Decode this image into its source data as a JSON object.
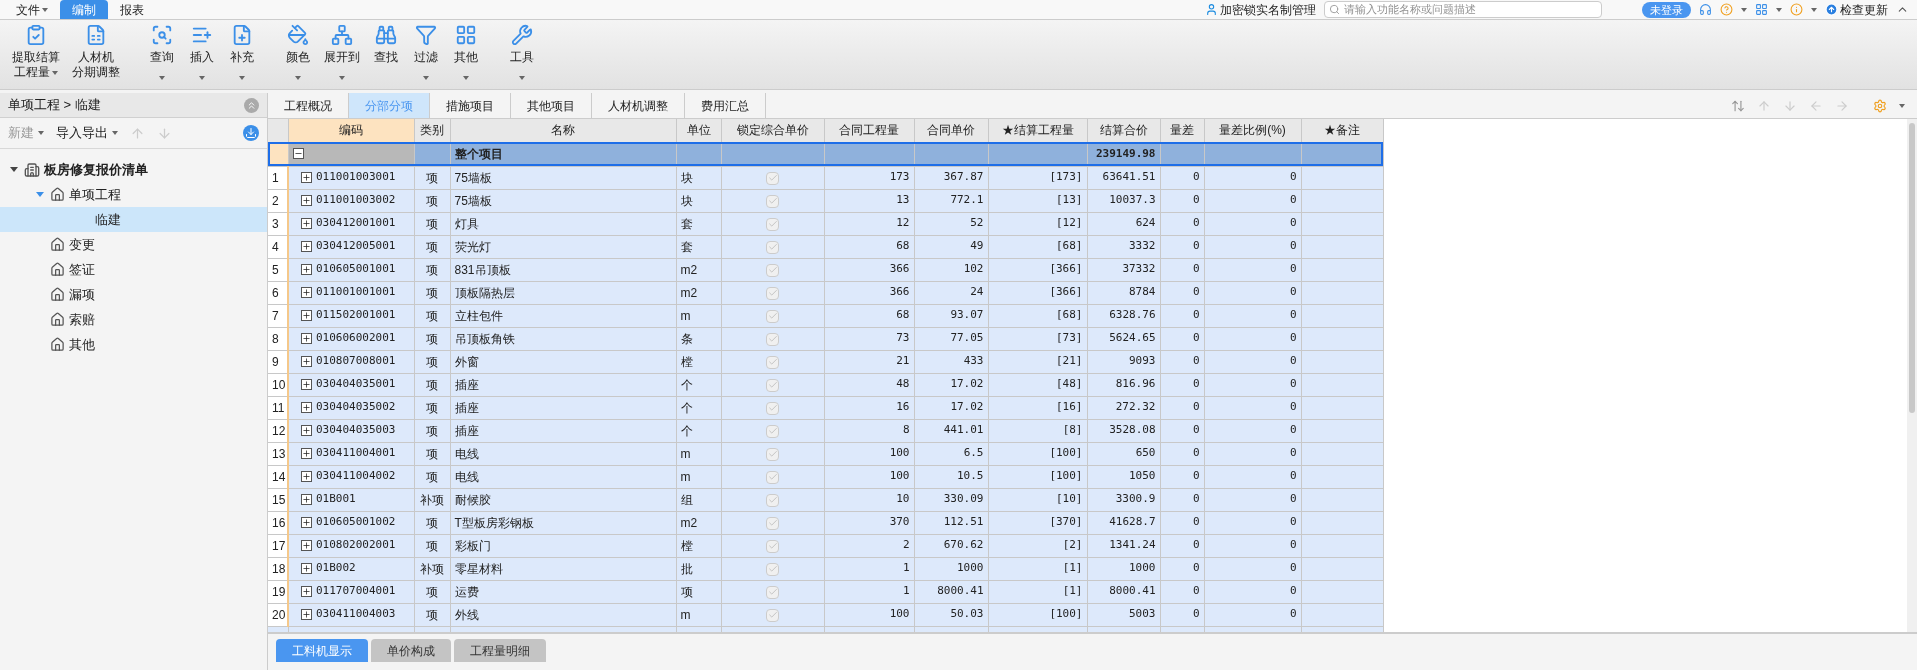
{
  "menu_tabs": [
    {
      "label": "文件",
      "selected": false,
      "dropdown": true
    },
    {
      "label": "编制",
      "selected": true,
      "dropdown": false
    },
    {
      "label": "报表",
      "selected": false,
      "dropdown": false
    }
  ],
  "top_right": {
    "account": "加密锁实名制管理",
    "search": {
      "placeholder": "请输入功能名称或问题描述"
    },
    "login": "未登录",
    "update": "检查更新"
  },
  "ribbon": [
    [
      {
        "lines": [
          "提取结算",
          "工程量"
        ],
        "dropdown": true
      },
      {
        "lines": [
          "人材机",
          "分期调整"
        ],
        "dropdown": false
      }
    ],
    [
      {
        "lines": [
          "查询"
        ],
        "dropdown": true
      },
      {
        "lines": [
          "插入"
        ],
        "dropdown": true
      },
      {
        "lines": [
          "补充"
        ],
        "dropdown": true
      }
    ],
    [
      {
        "lines": [
          "颜色"
        ],
        "dropdown": true
      },
      {
        "lines": [
          "展开到"
        ],
        "dropdown": true
      },
      {
        "lines": [
          "查找"
        ],
        "dropdown": false
      },
      {
        "lines": [
          "过滤"
        ],
        "dropdown": true
      },
      {
        "lines": [
          "其他"
        ],
        "dropdown": true
      }
    ],
    [
      {
        "lines": [
          "工具"
        ],
        "dropdown": true
      }
    ]
  ],
  "sidebar": {
    "breadcrumb": "单项工程 > 临建",
    "toolbar": [
      {
        "label": "新建",
        "disabled": true
      },
      {
        "label": "导入导出",
        "disabled": false
      }
    ],
    "tree": [
      {
        "label": "板房修复报价清单",
        "expanded": true,
        "selected": false,
        "children": [
          {
            "label": "单项工程",
            "expanded": true,
            "selected": false,
            "children": [
              {
                "label": "临建",
                "selected": true
              }
            ]
          },
          {
            "label": "变更",
            "selected": false
          },
          {
            "label": "签证",
            "selected": false
          },
          {
            "label": "漏项",
            "selected": false
          },
          {
            "label": "索赔",
            "selected": false
          },
          {
            "label": "其他",
            "selected": false
          }
        ]
      }
    ]
  },
  "content_tabs": [
    {
      "label": "工程概况",
      "selected": false
    },
    {
      "label": "分部分项",
      "selected": true
    },
    {
      "label": "措施项目",
      "selected": false
    },
    {
      "label": "其他项目",
      "selected": false
    },
    {
      "label": "人材机调整",
      "selected": false
    },
    {
      "label": "费用汇总",
      "selected": false
    }
  ],
  "table": {
    "columns": [
      {
        "label": "编码",
        "selected": true
      },
      {
        "label": "类别",
        "selected": false
      },
      {
        "label": "名称",
        "selected": false
      },
      {
        "label": "单位",
        "selected": false
      },
      {
        "label": "锁定综合单价",
        "selected": false
      },
      {
        "label": "合同工程量",
        "selected": false
      },
      {
        "label": "合同单价",
        "selected": false
      },
      {
        "label": "★结算工程量",
        "selected": false
      },
      {
        "label": "结算合价",
        "selected": false
      },
      {
        "label": "量差",
        "selected": false
      },
      {
        "label": "量差比例(%)",
        "selected": false
      },
      {
        "label": "★备注",
        "selected": false
      }
    ],
    "total_row": {
      "name": "整个项目",
      "settle_total": "239149.98",
      "expanded": true
    },
    "rows": [
      {
        "no": "1",
        "code": "011001003001",
        "type": "项",
        "name": "75墙板",
        "unit": "块",
        "locked": true,
        "qty": "173",
        "price": "367.87",
        "settle_qty": "[173]",
        "settle_total": "63641.51",
        "diff": "0",
        "ratio": "0"
      },
      {
        "no": "2",
        "code": "011001003002",
        "type": "项",
        "name": "75墙板",
        "unit": "块",
        "locked": true,
        "qty": "13",
        "price": "772.1",
        "settle_qty": "[13]",
        "settle_total": "10037.3",
        "diff": "0",
        "ratio": "0"
      },
      {
        "no": "3",
        "code": "030412001001",
        "type": "项",
        "name": "灯具",
        "unit": "套",
        "locked": true,
        "qty": "12",
        "price": "52",
        "settle_qty": "[12]",
        "settle_total": "624",
        "diff": "0",
        "ratio": "0"
      },
      {
        "no": "4",
        "code": "030412005001",
        "type": "项",
        "name": "荧光灯",
        "unit": "套",
        "locked": true,
        "qty": "68",
        "price": "49",
        "settle_qty": "[68]",
        "settle_total": "3332",
        "diff": "0",
        "ratio": "0"
      },
      {
        "no": "5",
        "code": "010605001001",
        "type": "项",
        "name": "831吊顶板",
        "unit": "m2",
        "locked": true,
        "qty": "366",
        "price": "102",
        "settle_qty": "[366]",
        "settle_total": "37332",
        "diff": "0",
        "ratio": "0"
      },
      {
        "no": "6",
        "code": "011001001001",
        "type": "项",
        "name": "顶板隔热层",
        "unit": "m2",
        "locked": true,
        "qty": "366",
        "price": "24",
        "settle_qty": "[366]",
        "settle_total": "8784",
        "diff": "0",
        "ratio": "0"
      },
      {
        "no": "7",
        "code": "011502001001",
        "type": "项",
        "name": "立柱包件",
        "unit": "m",
        "locked": true,
        "qty": "68",
        "price": "93.07",
        "settle_qty": "[68]",
        "settle_total": "6328.76",
        "diff": "0",
        "ratio": "0"
      },
      {
        "no": "8",
        "code": "010606002001",
        "type": "项",
        "name": "吊顶板角铁",
        "unit": "条",
        "locked": true,
        "qty": "73",
        "price": "77.05",
        "settle_qty": "[73]",
        "settle_total": "5624.65",
        "diff": "0",
        "ratio": "0"
      },
      {
        "no": "9",
        "code": "010807008001",
        "type": "项",
        "name": "外窗",
        "unit": "樘",
        "locked": true,
        "qty": "21",
        "price": "433",
        "settle_qty": "[21]",
        "settle_total": "9093",
        "diff": "0",
        "ratio": "0"
      },
      {
        "no": "10",
        "code": "030404035001",
        "type": "项",
        "name": "插座",
        "unit": "个",
        "locked": true,
        "qty": "48",
        "price": "17.02",
        "settle_qty": "[48]",
        "settle_total": "816.96",
        "diff": "0",
        "ratio": "0"
      },
      {
        "no": "11",
        "code": "030404035002",
        "type": "项",
        "name": "插座",
        "unit": "个",
        "locked": true,
        "qty": "16",
        "price": "17.02",
        "settle_qty": "[16]",
        "settle_total": "272.32",
        "diff": "0",
        "ratio": "0"
      },
      {
        "no": "12",
        "code": "030404035003",
        "type": "项",
        "name": "插座",
        "unit": "个",
        "locked": true,
        "qty": "8",
        "price": "441.01",
        "settle_qty": "[8]",
        "settle_total": "3528.08",
        "diff": "0",
        "ratio": "0"
      },
      {
        "no": "13",
        "code": "030411004001",
        "type": "项",
        "name": "电线",
        "unit": "m",
        "locked": true,
        "qty": "100",
        "price": "6.5",
        "settle_qty": "[100]",
        "settle_total": "650",
        "diff": "0",
        "ratio": "0"
      },
      {
        "no": "14",
        "code": "030411004002",
        "type": "项",
        "name": "电线",
        "unit": "m",
        "locked": true,
        "qty": "100",
        "price": "10.5",
        "settle_qty": "[100]",
        "settle_total": "1050",
        "diff": "0",
        "ratio": "0"
      },
      {
        "no": "15",
        "code": "01B001",
        "type": "补项",
        "name": "耐候胶",
        "unit": "组",
        "locked": true,
        "qty": "10",
        "price": "330.09",
        "settle_qty": "[10]",
        "settle_total": "3300.9",
        "diff": "0",
        "ratio": "0"
      },
      {
        "no": "16",
        "code": "010605001002",
        "type": "项",
        "name": "T型板房彩钢板",
        "unit": "m2",
        "locked": true,
        "qty": "370",
        "price": "112.51",
        "settle_qty": "[370]",
        "settle_total": "41628.7",
        "diff": "0",
        "ratio": "0"
      },
      {
        "no": "17",
        "code": "010802002001",
        "type": "项",
        "name": "彩板门",
        "unit": "樘",
        "locked": true,
        "qty": "2",
        "price": "670.62",
        "settle_qty": "[2]",
        "settle_total": "1341.24",
        "diff": "0",
        "ratio": "0"
      },
      {
        "no": "18",
        "code": "01B002",
        "type": "补项",
        "name": "零星材料",
        "unit": "批",
        "locked": true,
        "qty": "1",
        "price": "1000",
        "settle_qty": "[1]",
        "settle_total": "1000",
        "diff": "0",
        "ratio": "0"
      },
      {
        "no": "19",
        "code": "011707004001",
        "type": "项",
        "name": "运费",
        "unit": "项",
        "locked": true,
        "qty": "1",
        "price": "8000.41",
        "settle_qty": "[1]",
        "settle_total": "8000.41",
        "diff": "0",
        "ratio": "0"
      },
      {
        "no": "20",
        "code": "030411004003",
        "type": "项",
        "name": "外线",
        "unit": "m",
        "locked": true,
        "qty": "100",
        "price": "50.03",
        "settle_qty": "[100]",
        "settle_total": "5003",
        "diff": "0",
        "ratio": "0"
      }
    ]
  },
  "bottom_tabs": [
    {
      "label": "工料机显示",
      "selected": true
    },
    {
      "label": "单价构成",
      "selected": false
    },
    {
      "label": "工程量明细",
      "selected": false
    }
  ]
}
